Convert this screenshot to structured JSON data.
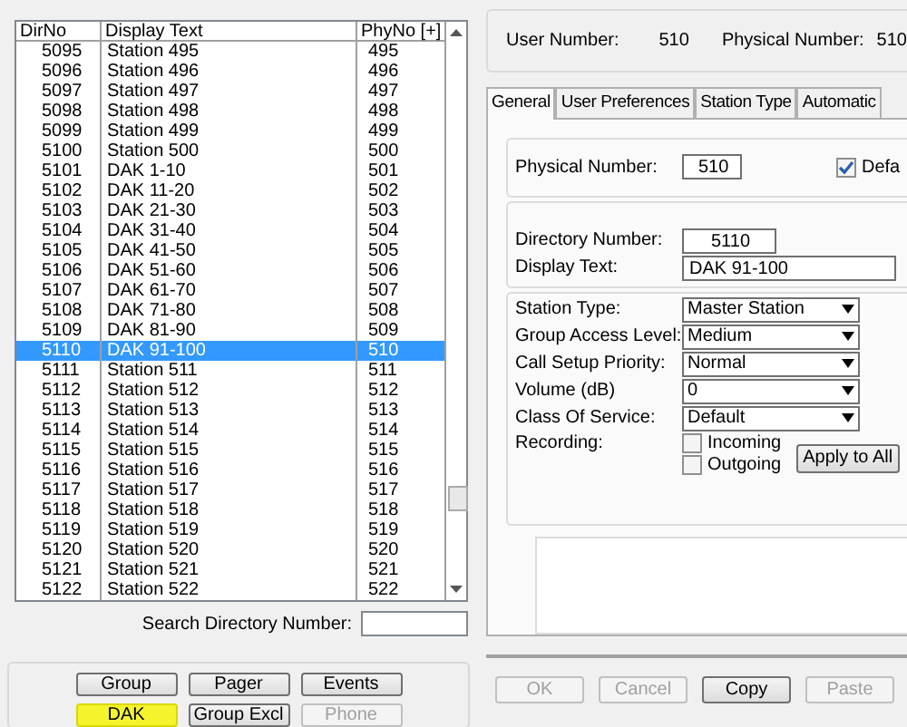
{
  "directory_table": {
    "columns": [
      "DirNo",
      "Display Text",
      "PhyNo [+]"
    ],
    "rows": [
      {
        "dir": "5095",
        "text": "Station 495",
        "phy": "495",
        "selected": false
      },
      {
        "dir": "5096",
        "text": "Station 496",
        "phy": "496",
        "selected": false
      },
      {
        "dir": "5097",
        "text": "Station 497",
        "phy": "497",
        "selected": false
      },
      {
        "dir": "5098",
        "text": "Station 498",
        "phy": "498",
        "selected": false
      },
      {
        "dir": "5099",
        "text": "Station 499",
        "phy": "499",
        "selected": false
      },
      {
        "dir": "5100",
        "text": "Station 500",
        "phy": "500",
        "selected": false
      },
      {
        "dir": "5101",
        "text": "DAK 1-10",
        "phy": "501",
        "selected": false
      },
      {
        "dir": "5102",
        "text": "DAK 11-20",
        "phy": "502",
        "selected": false
      },
      {
        "dir": "5103",
        "text": "DAK 21-30",
        "phy": "503",
        "selected": false
      },
      {
        "dir": "5104",
        "text": "DAK 31-40",
        "phy": "504",
        "selected": false
      },
      {
        "dir": "5105",
        "text": "DAK 41-50",
        "phy": "505",
        "selected": false
      },
      {
        "dir": "5106",
        "text": "DAK 51-60",
        "phy": "506",
        "selected": false
      },
      {
        "dir": "5107",
        "text": "DAK 61-70",
        "phy": "507",
        "selected": false
      },
      {
        "dir": "5108",
        "text": "DAK 71-80",
        "phy": "508",
        "selected": false
      },
      {
        "dir": "5109",
        "text": "DAK 81-90",
        "phy": "509",
        "selected": false
      },
      {
        "dir": "5110",
        "text": "DAK 91-100",
        "phy": "510",
        "selected": true
      },
      {
        "dir": "5111",
        "text": "Station 511",
        "phy": "511",
        "selected": false
      },
      {
        "dir": "5112",
        "text": "Station 512",
        "phy": "512",
        "selected": false
      },
      {
        "dir": "5113",
        "text": "Station 513",
        "phy": "513",
        "selected": false
      },
      {
        "dir": "5114",
        "text": "Station 514",
        "phy": "514",
        "selected": false
      },
      {
        "dir": "5115",
        "text": "Station 515",
        "phy": "515",
        "selected": false
      },
      {
        "dir": "5116",
        "text": "Station 516",
        "phy": "516",
        "selected": false
      },
      {
        "dir": "5117",
        "text": "Station 517",
        "phy": "517",
        "selected": false
      },
      {
        "dir": "5118",
        "text": "Station 518",
        "phy": "518",
        "selected": false
      },
      {
        "dir": "5119",
        "text": "Station 519",
        "phy": "519",
        "selected": false
      },
      {
        "dir": "5120",
        "text": "Station 520",
        "phy": "520",
        "selected": false
      },
      {
        "dir": "5121",
        "text": "Station 521",
        "phy": "521",
        "selected": false
      },
      {
        "dir": "5122",
        "text": "Station 522",
        "phy": "522",
        "selected": false
      }
    ]
  },
  "search": {
    "label": "Search Directory Number:"
  },
  "type_buttons": [
    {
      "label": "Group",
      "highlighted": false,
      "disabled": false
    },
    {
      "label": "Pager",
      "highlighted": false,
      "disabled": false
    },
    {
      "label": "Events",
      "highlighted": false,
      "disabled": false
    },
    {
      "label": "DAK",
      "highlighted": true,
      "disabled": false
    },
    {
      "label": "Group Excl",
      "highlighted": false,
      "disabled": false
    },
    {
      "label": "Phone",
      "highlighted": false,
      "disabled": true
    }
  ],
  "header": {
    "user_number_label": "User Number:",
    "user_number": "510",
    "physical_number_label": "Physical Number:",
    "physical_number": "510"
  },
  "tabs": [
    {
      "label": "General",
      "selected": true
    },
    {
      "label": "User Preferences",
      "selected": false
    },
    {
      "label": "Station Type",
      "selected": false
    },
    {
      "label": "Automatic",
      "selected": false
    }
  ],
  "physical": {
    "label": "Physical Number:",
    "value": "510",
    "default_label": "Defa",
    "default_checked": true
  },
  "directory": {
    "label": "Directory Number:",
    "value": "5110"
  },
  "display_text": {
    "label": "Display Text:",
    "value": "DAK 91-100"
  },
  "dropdowns": [
    {
      "label": "Station Type:",
      "value": "Master Station"
    },
    {
      "label": "Group Access Level:",
      "value": "Medium"
    },
    {
      "label": "Call Setup Priority:",
      "value": "Normal"
    },
    {
      "label": "Volume (dB)",
      "value": "0"
    },
    {
      "label": "Class Of Service:",
      "value": "Default"
    }
  ],
  "recording": {
    "label": "Recording:",
    "options": [
      {
        "label": "Incoming",
        "checked": false
      },
      {
        "label": "Outgoing",
        "checked": false
      }
    ],
    "apply_button": "Apply to All"
  },
  "footer_buttons": [
    {
      "label": "OK",
      "disabled": true
    },
    {
      "label": "Cancel",
      "disabled": true
    },
    {
      "label": "Copy",
      "disabled": false
    },
    {
      "label": "Paste",
      "disabled": true
    }
  ]
}
